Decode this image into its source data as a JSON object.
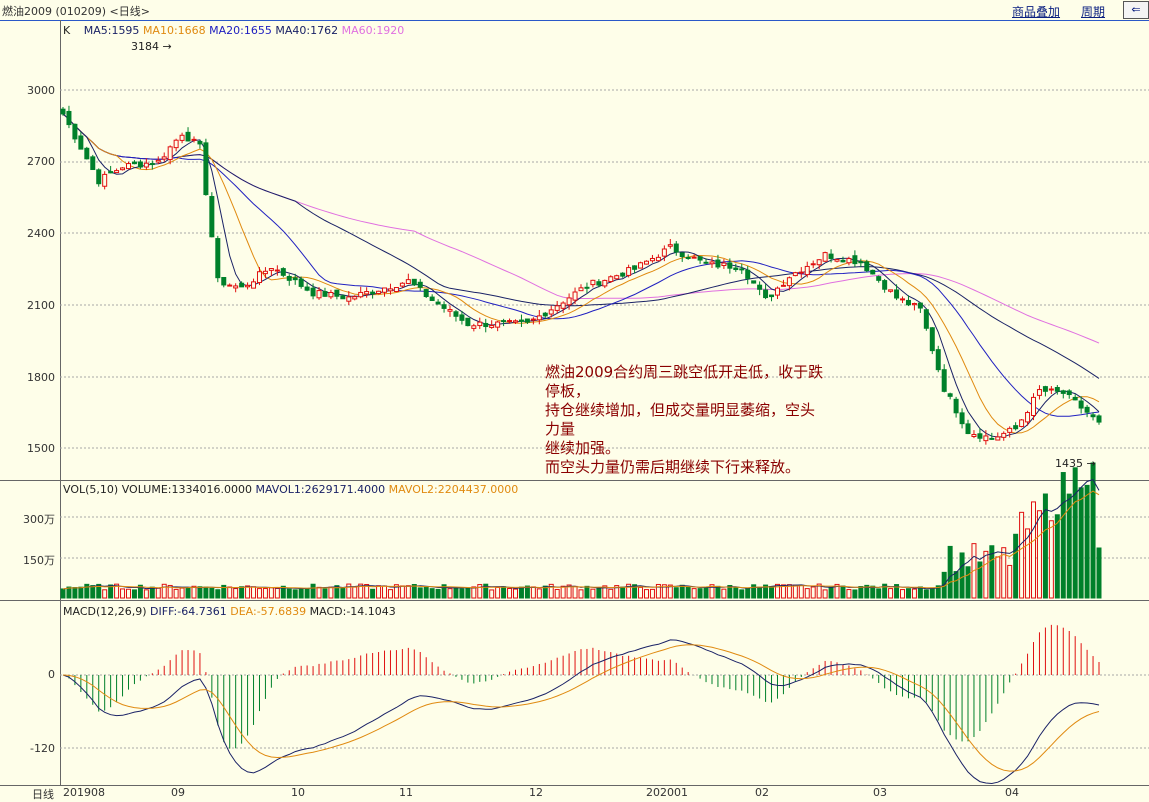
{
  "header": {
    "title": "燃油2009 (010209) <日线>",
    "overlay_link": "商品叠加",
    "period_link": "周期",
    "exit_icon": "exit-icon"
  },
  "price_panel": {
    "k_label": "K",
    "ma5": "MA5:1595",
    "ma10": "MA10:1668",
    "ma20": "MA20:1655",
    "ma40": "MA40:1762",
    "ma60": "MA60:1920",
    "high_marker": "3184",
    "low_marker": "1435",
    "y_ticks": [
      "3000",
      "2700",
      "2400",
      "2100",
      "1800",
      "1500"
    ]
  },
  "annotation": {
    "lines": [
      "燃油2009合约周三跳空低开走低，收于跌",
      "停板，",
      "持仓继续增加，但成交量明显萎缩，空头",
      "力量",
      "继续加强。",
      "而空头力量仍需后期继续下行来释放。"
    ]
  },
  "volume_panel": {
    "label": "VOL(5,10)",
    "volume": "VOLUME:1334016.0000",
    "mavol1": "MAVOL1:2629171.4000",
    "mavol2": "MAVOL2:2204437.0000",
    "y_ticks": [
      "300万",
      "150万"
    ]
  },
  "macd_panel": {
    "label": "MACD(12,26,9)",
    "diff": "DIFF:-64.7361",
    "dea": "DEA:-57.6839",
    "macd": "MACD:-14.1043",
    "y_ticks": [
      "0",
      "-120"
    ]
  },
  "x_axis": {
    "period": "日线",
    "ticks": [
      "201908",
      "09",
      "10",
      "11",
      "12",
      "202001",
      "02",
      "03",
      "04"
    ]
  },
  "colors": {
    "up": "#e01010",
    "down": "#00802a",
    "ma5": "#1a2266",
    "ma10": "#e08a10",
    "ma20": "#2020c0",
    "ma60": "#e070e0",
    "annotation": "#8a0000",
    "link": "#0a1f80"
  }
}
